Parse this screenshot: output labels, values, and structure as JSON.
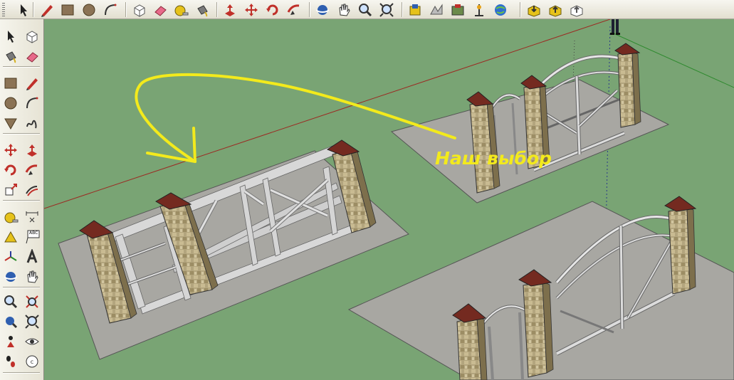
{
  "toolbar": {
    "buttons": [
      {
        "name": "select-icon"
      },
      {
        "name": "pencil-icon"
      },
      {
        "name": "rectangle-icon"
      },
      {
        "name": "circle-icon"
      },
      {
        "name": "arc-icon"
      },
      {
        "name": "make-component-icon"
      },
      {
        "name": "eraser-icon"
      },
      {
        "name": "tape-measure-icon"
      },
      {
        "name": "paint-bucket-icon"
      },
      {
        "name": "push-pull-icon"
      },
      {
        "name": "move-icon"
      },
      {
        "name": "rotate-icon"
      },
      {
        "name": "follow-me-icon"
      },
      {
        "name": "orbit-icon"
      },
      {
        "name": "pan-icon"
      },
      {
        "name": "zoom-icon"
      },
      {
        "name": "zoom-extents-icon"
      },
      {
        "name": "add-location-icon"
      },
      {
        "name": "toggle-terrain-icon"
      },
      {
        "name": "photo-textures-icon"
      },
      {
        "name": "add-model-icon"
      },
      {
        "name": "preview-google-earth-icon"
      },
      {
        "name": "get-models-icon"
      },
      {
        "name": "share-model-icon"
      },
      {
        "name": "share-component-icon"
      }
    ]
  },
  "sidebar": {
    "tools": [
      {
        "name": "select-icon"
      },
      {
        "name": "make-component-icon"
      },
      {
        "name": "paint-bucket-icon"
      },
      {
        "name": "eraser-icon"
      },
      {
        "name": "rectangle-icon"
      },
      {
        "name": "line-icon"
      },
      {
        "name": "circle-icon"
      },
      {
        "name": "arc-icon"
      },
      {
        "name": "polygon-icon"
      },
      {
        "name": "freehand-icon"
      },
      {
        "name": "move-icon"
      },
      {
        "name": "push-pull-icon"
      },
      {
        "name": "rotate-icon"
      },
      {
        "name": "follow-me-icon"
      },
      {
        "name": "scale-icon"
      },
      {
        "name": "offset-icon"
      },
      {
        "name": "tape-measure-icon"
      },
      {
        "name": "dimension-icon"
      },
      {
        "name": "protractor-icon"
      },
      {
        "name": "text-icon"
      },
      {
        "name": "axes-icon"
      },
      {
        "name": "3d-text-icon"
      },
      {
        "name": "orbit-icon"
      },
      {
        "name": "pan-icon"
      },
      {
        "name": "zoom-icon"
      },
      {
        "name": "zoom-window-icon"
      },
      {
        "name": "previous-view-icon"
      },
      {
        "name": "zoom-extents-icon"
      },
      {
        "name": "position-camera-icon"
      },
      {
        "name": "look-around-icon"
      },
      {
        "name": "walk-icon"
      },
      {
        "name": "section-plane-icon"
      }
    ],
    "text_tool_label": "ABC"
  },
  "viewport": {
    "caption": "Наш выбор"
  },
  "colors": {
    "ground": "#79a474",
    "slab": "#a8a7a2",
    "pillar_stone": "#b4a47a",
    "cap": "#7a2a1e",
    "frame": "#dcdcdc",
    "annotation": "#f3ea1c",
    "red_axis": "#9c2a22",
    "green_axis": "#2f8a2f"
  }
}
